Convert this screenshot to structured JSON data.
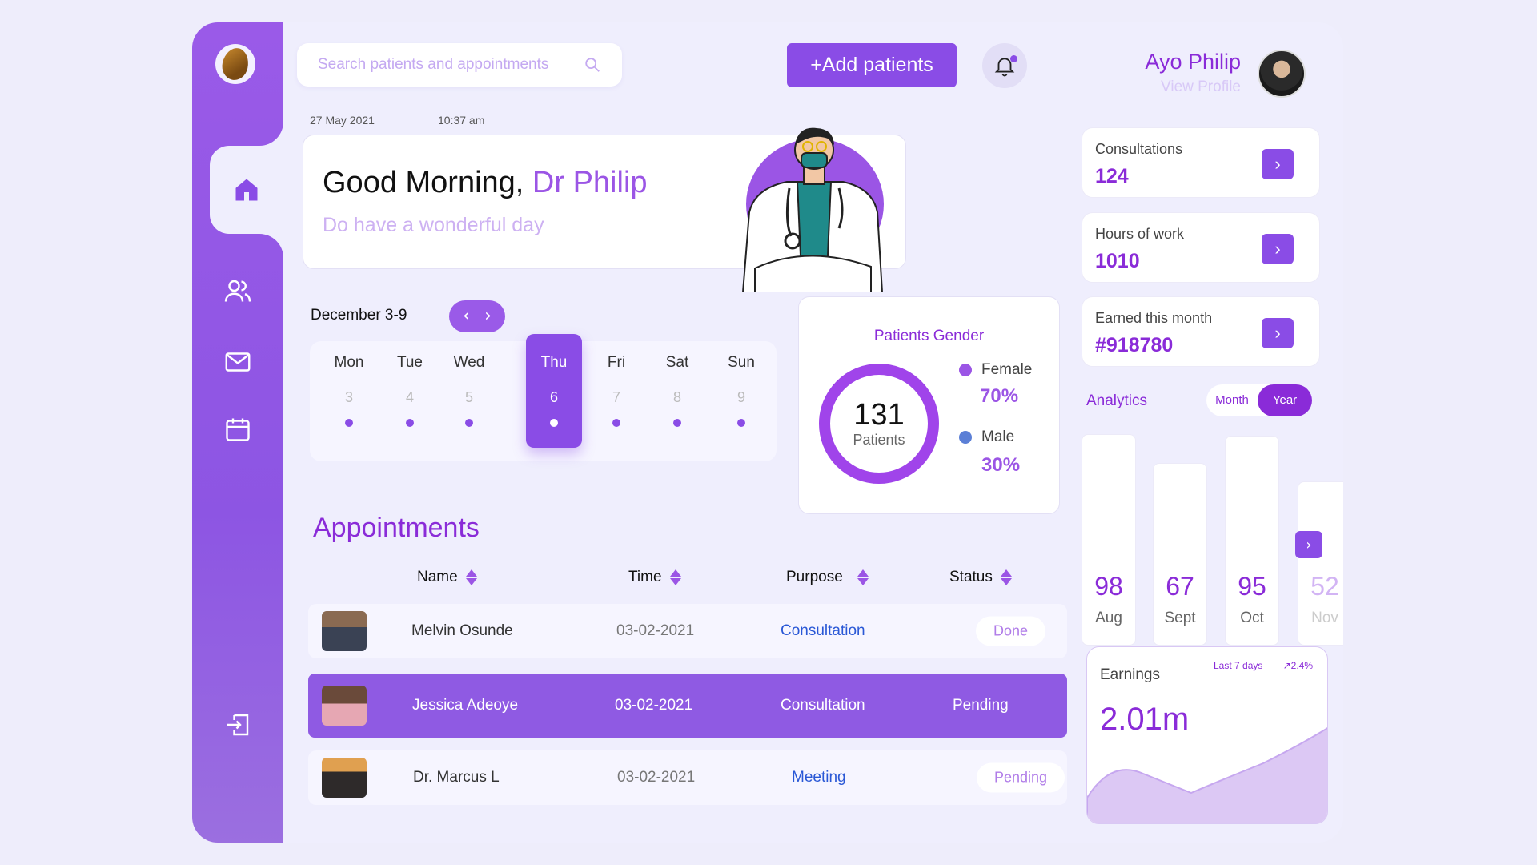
{
  "search": {
    "placeholder": "Search patients and appointments"
  },
  "header": {
    "add_button": "+Add patients"
  },
  "profile": {
    "name": "Ayo Philip",
    "link": "View Profile"
  },
  "date": {
    "day": "27 May 2021",
    "time": "10:37 am"
  },
  "greeting": {
    "hello": "Good Morning, ",
    "name": "Dr Philip",
    "subtitle": "Do have a wonderful day"
  },
  "calendar": {
    "range_label": "December 3-9",
    "days": [
      {
        "name": "Mon",
        "date": "3"
      },
      {
        "name": "Tue",
        "date": "4"
      },
      {
        "name": "Wed",
        "date": "5"
      },
      {
        "name": "Thu",
        "date": "6"
      },
      {
        "name": "Fri",
        "date": "7"
      },
      {
        "name": "Sat",
        "date": "8"
      },
      {
        "name": "Sun",
        "date": "9"
      }
    ],
    "selected": "Thu"
  },
  "gender": {
    "title": "Patients Gender",
    "total": "131",
    "total_label": "Patients",
    "female_label": "Female",
    "female_pct": "70%",
    "male_label": "Male",
    "male_pct": "30%",
    "female_fraction": 0.7,
    "colors": {
      "female": "#9b55e5",
      "male": "#5b7fd6"
    }
  },
  "appointments": {
    "title": "Appointments",
    "columns": {
      "name": "Name",
      "time": "Time",
      "purpose": "Purpose",
      "status": "Status"
    },
    "rows": [
      {
        "name": "Melvin Osunde",
        "time": "03-02-2021",
        "purpose": "Consultation",
        "status": "Done"
      },
      {
        "name": "Jessica Adeoye",
        "time": "03-02-2021",
        "purpose": "Consultation",
        "status": "Pending"
      },
      {
        "name": "Dr. Marcus L",
        "time": "03-02-2021",
        "purpose": "Meeting",
        "status": "Pending"
      }
    ]
  },
  "stats": {
    "consultations_label": "Consultations",
    "consultations_value": "124",
    "hours_label": "Hours of work",
    "hours_value": "1010",
    "earned_label": "Earned this month",
    "earned_value": "#918780"
  },
  "analytics": {
    "title": "Analytics",
    "toggle_month": "Month",
    "toggle_year": "Year",
    "bars": [
      {
        "value": "98",
        "label": "Aug"
      },
      {
        "value": "67",
        "label": "Sept"
      },
      {
        "value": "95",
        "label": "Oct"
      },
      {
        "value": "52",
        "label": "Nov"
      }
    ]
  },
  "earnings": {
    "label": "Earnings",
    "value": "2.01m",
    "period": "Last 7 days",
    "growth": "2.4%"
  },
  "icons": {
    "home": "home-icon",
    "users": "users-icon",
    "mail": "mail-icon",
    "calendar": "calendar-icon",
    "logout": "logout-icon",
    "search": "search-icon",
    "bell": "bell-icon"
  },
  "colors": {
    "accent": "#8a4ce6",
    "accent_text": "#8a2bd8",
    "background": "#eeedfb"
  }
}
